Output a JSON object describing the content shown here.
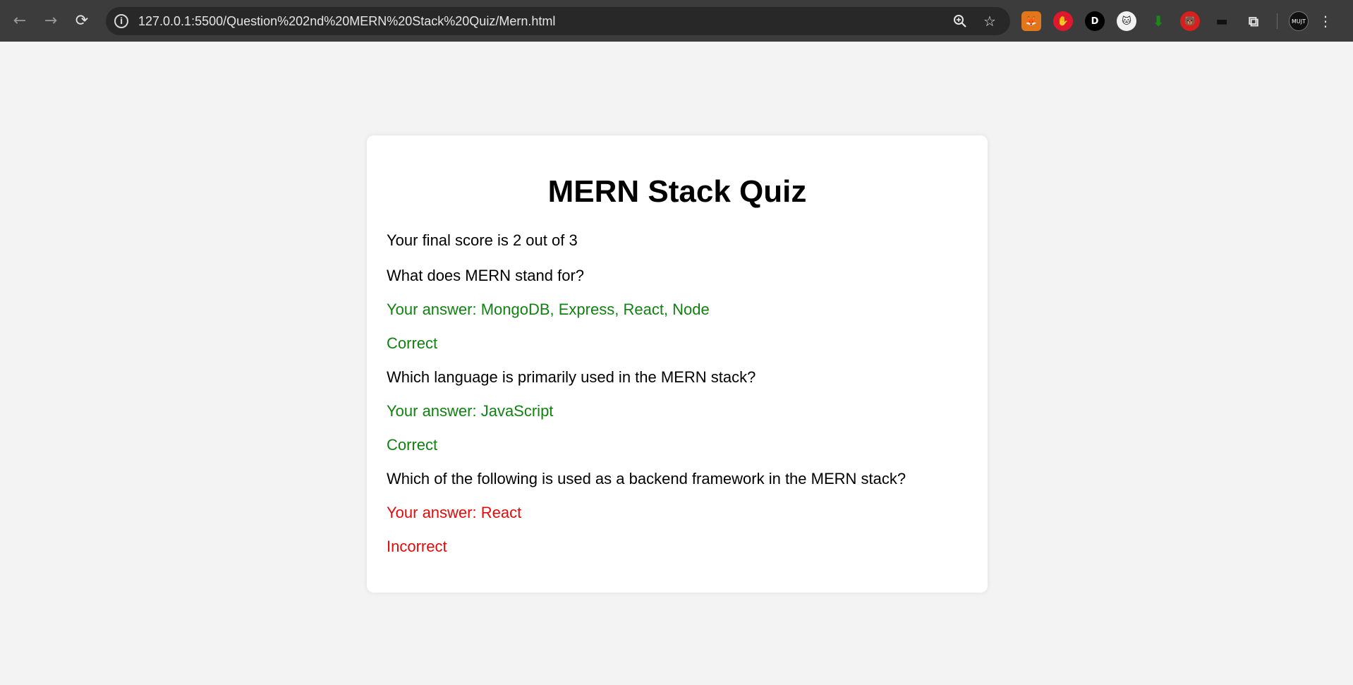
{
  "browser": {
    "url": "127.0.0.1:5500/Question%202nd%20MERN%20Stack%20Quiz/Mern.html",
    "icons": {
      "back": "arrow-left-icon",
      "forward": "arrow-right-icon",
      "reload": "reload-icon",
      "info": "info-icon",
      "zoom": "zoom-icon",
      "bookmark": "star-icon",
      "extensions": "puzzle-icon",
      "menu": "kebab-menu-icon"
    },
    "extensions": [
      {
        "name": "metamask-extension-icon",
        "glyph": "🦊",
        "color": "#e2761b"
      },
      {
        "name": "adblock-extension-icon",
        "glyph": "✋",
        "color": "#e0182d"
      },
      {
        "name": "d-extension-icon",
        "glyph": "D",
        "color": "#000000"
      },
      {
        "name": "github-cat-extension-icon",
        "glyph": "🐱",
        "color": "#222222"
      },
      {
        "name": "green-arrow-extension-icon",
        "glyph": "⬇",
        "color": "#1a8a1a"
      },
      {
        "name": "red-mascot-extension-icon",
        "glyph": "🐻",
        "color": "#d91e1e"
      },
      {
        "name": "dark-tool-extension-icon",
        "glyph": "▬",
        "color": "#111111"
      }
    ],
    "profile_label": "MUJT"
  },
  "quiz": {
    "title": "MERN Stack Quiz",
    "score_text": "Your final score is 2 out of 3",
    "results": [
      {
        "question": "What does MERN stand for?",
        "answer": "Your answer: MongoDB, Express, React, Node",
        "verdict": "Correct",
        "status": "correct"
      },
      {
        "question": "Which language is primarily used in the MERN stack?",
        "answer": "Your answer: JavaScript",
        "verdict": "Correct",
        "status": "correct"
      },
      {
        "question": "Which of the following is used as a backend framework in the MERN stack?",
        "answer": "Your answer: React",
        "verdict": "Incorrect",
        "status": "incorrect"
      }
    ]
  },
  "colors": {
    "correct": "#128012",
    "incorrect": "#e00c0c",
    "toolbar": "#3c3c3c",
    "page_bg": "#f3f3f3",
    "card_bg": "#ffffff"
  }
}
